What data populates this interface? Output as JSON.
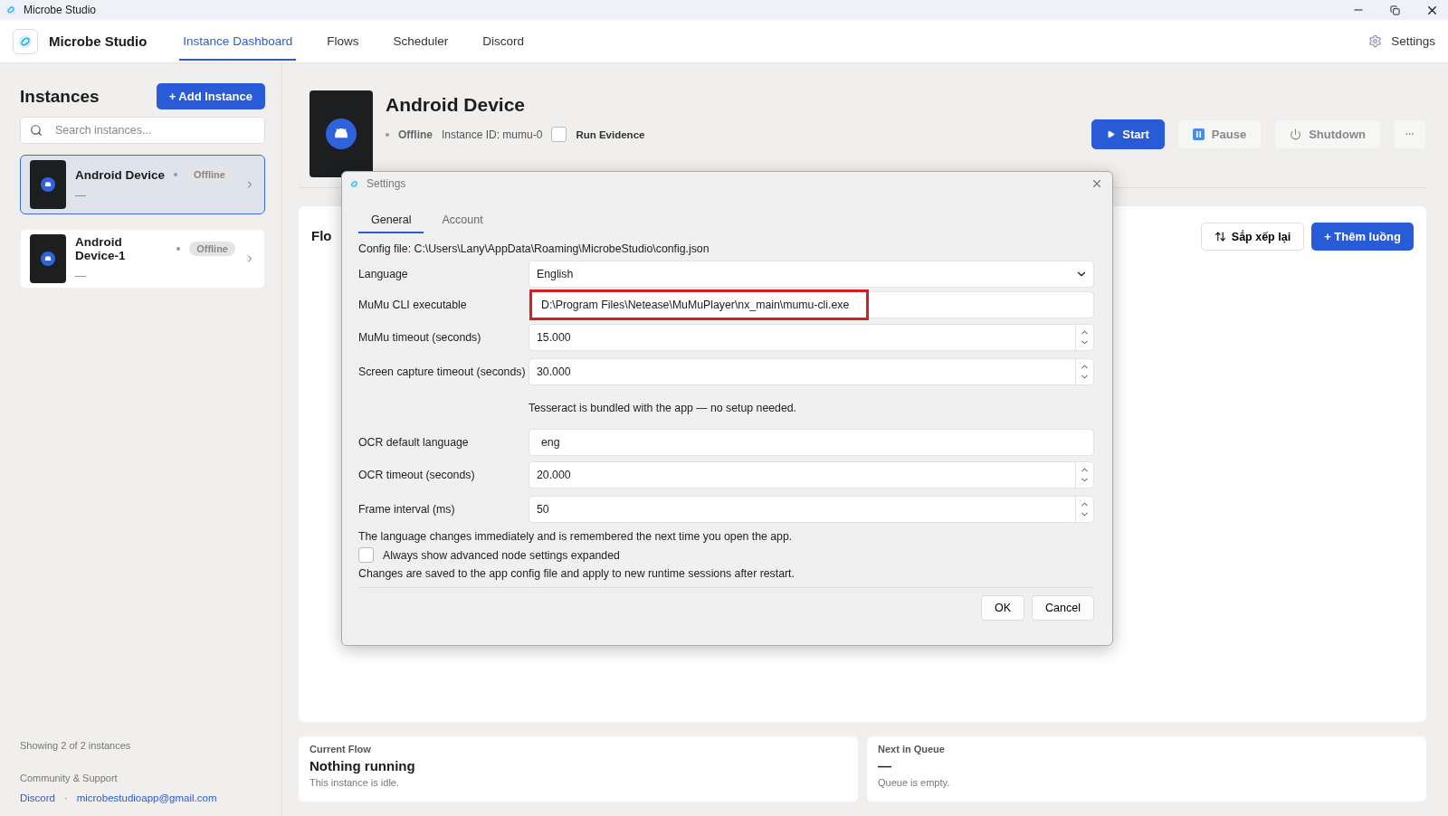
{
  "window": {
    "title": "Microbe Studio"
  },
  "header": {
    "app_name": "Microbe Studio",
    "tabs": [
      {
        "label": "Instance Dashboard",
        "selected": true
      },
      {
        "label": "Flows",
        "selected": false
      },
      {
        "label": "Scheduler",
        "selected": false
      },
      {
        "label": "Discord",
        "selected": false
      }
    ],
    "settings_label": "Settings"
  },
  "sidebar": {
    "title": "Instances",
    "add_button": "+ Add Instance",
    "search": {
      "placeholder": "Search instances..."
    },
    "instances": [
      {
        "name": "Android Device",
        "status": "Offline",
        "subtitle": "—",
        "selected": true
      },
      {
        "name": "Android Device-1",
        "status": "Offline",
        "subtitle": "—",
        "selected": false
      }
    ],
    "count": "Showing 2 of 2 instances",
    "community_title": "Community & Support",
    "links": [
      "Discord",
      "microbestudioapp@gmail.com"
    ],
    "link_separator": "·"
  },
  "device": {
    "name": "Android Device",
    "status": "Offline",
    "instance_id": "Instance ID: mumu-0",
    "run_evidence": {
      "label": "Run Evidence",
      "checked": false
    },
    "buttons": [
      {
        "label": "Start",
        "kind": "start"
      },
      {
        "label": "Pause",
        "kind": "pause"
      },
      {
        "label": "Shutdown",
        "kind": "shutdown"
      },
      {
        "label": "···",
        "kind": "more"
      }
    ]
  },
  "flows": {
    "title": "Flo",
    "buttons": [
      {
        "label": "Sắp xếp lại",
        "kind": "sort"
      },
      {
        "label": "+ Thêm luồng",
        "kind": "primary"
      }
    ]
  },
  "cards": [
    {
      "label": "Current Flow",
      "value": "Nothing running",
      "note": "This instance is idle."
    },
    {
      "label": "Next in Queue",
      "value": "—",
      "note": "Queue is empty."
    }
  ],
  "dialog": {
    "title": "Settings",
    "tabs": [
      {
        "label": "General",
        "selected": true
      },
      {
        "label": "Account",
        "selected": false
      }
    ],
    "config_file": "Config file: C:\\Users\\Lany\\AppData\\Roaming\\MicrobeStudio\\config.json",
    "fields": [
      {
        "kind": "select",
        "label": "Language",
        "value": "English"
      },
      {
        "kind": "text",
        "label": "MuMu CLI executable",
        "value": "D:\\Program Files\\Netease\\MuMuPlayer\\nx_main\\mumu-cli.exe",
        "highlighted": true
      },
      {
        "kind": "spin",
        "label": "MuMu timeout (seconds)",
        "value": "15.000"
      },
      {
        "kind": "spin",
        "label": "Screen capture timeout (seconds)",
        "value": "30.000"
      },
      {
        "kind": "note",
        "text": "Tesseract is bundled with the app — no setup needed."
      },
      {
        "kind": "text",
        "label": "OCR default language",
        "value": "eng",
        "highlighted": false
      },
      {
        "kind": "spin",
        "label": "OCR timeout (seconds)",
        "value": "20.000"
      },
      {
        "kind": "spin",
        "label": "Frame interval (ms)",
        "value": "50"
      }
    ],
    "language_note": "The language changes immediately and is remembered the next time you open the app.",
    "advanced": {
      "label": "Always show advanced node settings expanded",
      "checked": false
    },
    "save_note": "Changes are saved to the app config file and apply to new runtime sessions after restart.",
    "buttons": [
      "OK",
      "Cancel"
    ]
  }
}
